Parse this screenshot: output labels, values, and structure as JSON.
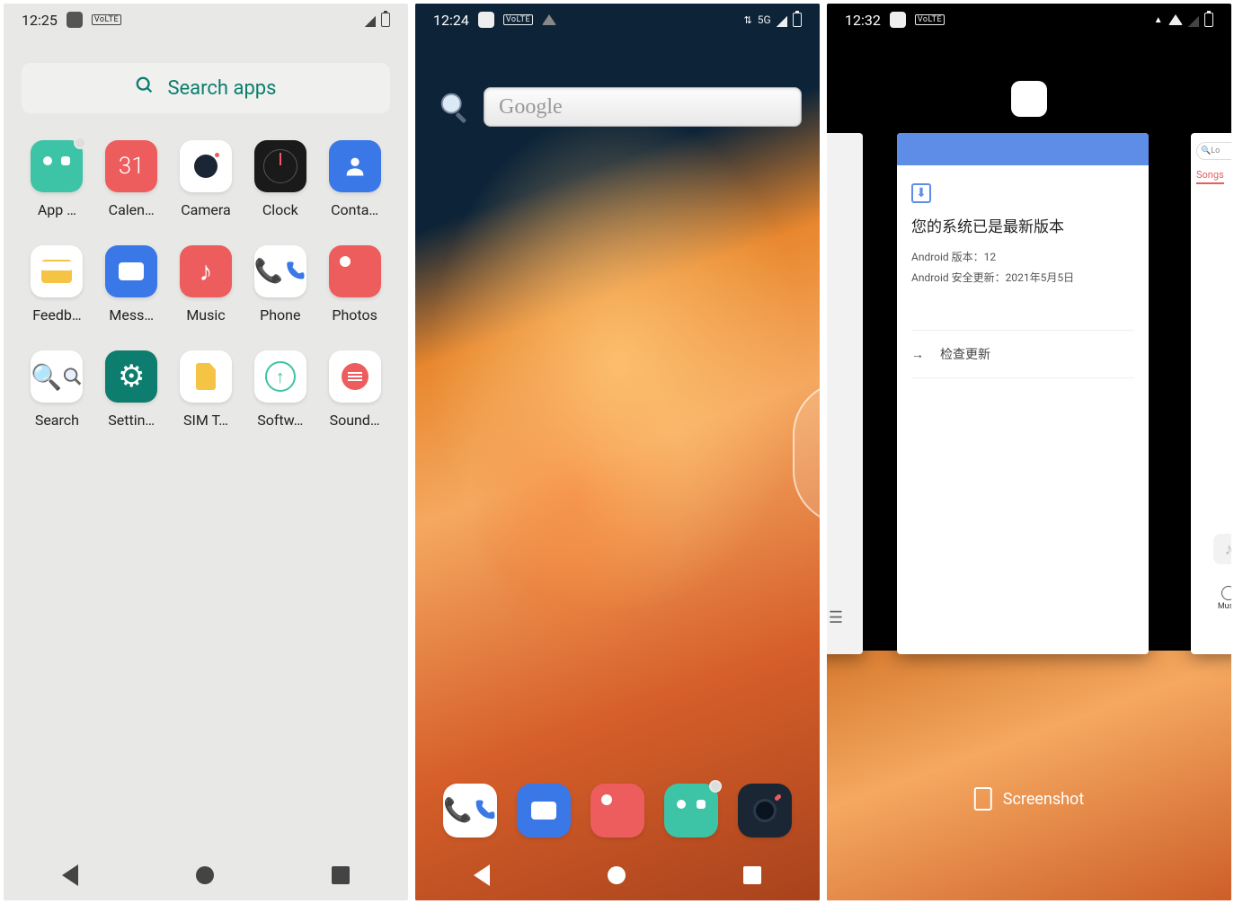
{
  "phone1": {
    "status": {
      "time": "12:25",
      "volte": "VoLTE"
    },
    "search_label": "Search apps",
    "apps": [
      {
        "id": "appmarket",
        "label": "App …"
      },
      {
        "id": "calendar",
        "label": "Calen…",
        "day": "31"
      },
      {
        "id": "camera",
        "label": "Camera"
      },
      {
        "id": "clock",
        "label": "Clock"
      },
      {
        "id": "contacts",
        "label": "Conta…"
      },
      {
        "id": "feedback",
        "label": "Feedb…"
      },
      {
        "id": "messages",
        "label": "Mess…"
      },
      {
        "id": "music",
        "label": "Music"
      },
      {
        "id": "phone",
        "label": "Phone"
      },
      {
        "id": "photos",
        "label": "Photos"
      },
      {
        "id": "search",
        "label": "Search"
      },
      {
        "id": "settings",
        "label": "Settin…"
      },
      {
        "id": "sim",
        "label": "SIM T…"
      },
      {
        "id": "software",
        "label": "Softw…"
      },
      {
        "id": "sound",
        "label": "Sound…"
      }
    ]
  },
  "phone2": {
    "status": {
      "time": "12:24",
      "volte": "VoLTE",
      "network": "5G"
    },
    "google_placeholder": "Google",
    "dock": [
      "phone",
      "messages",
      "photos",
      "appmarket",
      "camera"
    ]
  },
  "phone3": {
    "status": {
      "time": "12:32",
      "volte": "VoLTE"
    },
    "update_card": {
      "title": "您的系统已是最新版本",
      "line1": "Android 版本：12",
      "line2": "Android 安全更新：2021年5月5日",
      "check": "检查更新"
    },
    "right_card": {
      "search_hint": "Lo",
      "tab": "Songs",
      "float_label": "Music"
    },
    "screenshot_label": "Screenshot"
  }
}
